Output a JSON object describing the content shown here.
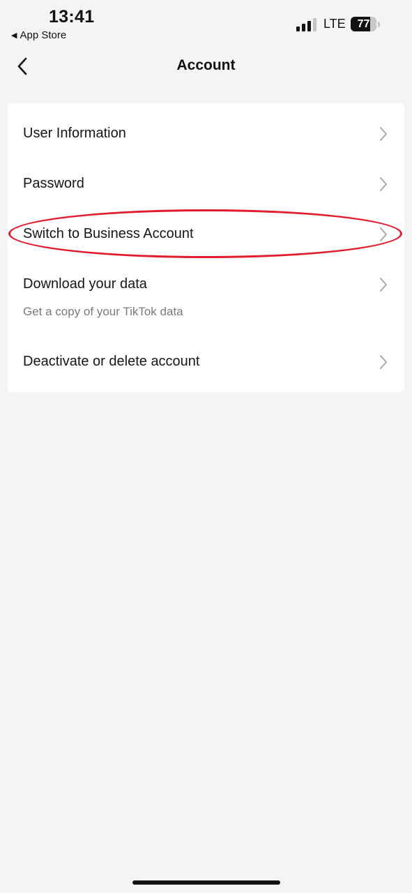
{
  "status_bar": {
    "time": "13:41",
    "back_app_label": "App Store",
    "back_arrow_glyph": "◀",
    "network": "LTE",
    "battery": "77",
    "battery_level": 0.77,
    "signal_bars_active": 3,
    "signal_bars_total": 4
  },
  "header": {
    "title": "Account",
    "back_icon": "chevron-left-icon"
  },
  "menu": {
    "items": [
      {
        "label": "User Information",
        "icon": "chevron-right-icon"
      },
      {
        "label": "Password",
        "icon": "chevron-right-icon"
      },
      {
        "label": "Switch to Business Account",
        "icon": "chevron-right-icon",
        "highlighted": true
      },
      {
        "label": "Download your data",
        "subtitle": "Get a copy of your TikTok data",
        "icon": "chevron-right-icon"
      },
      {
        "label": "Deactivate or delete account",
        "icon": "chevron-right-icon"
      }
    ]
  },
  "colors": {
    "background": "#f4f4f4",
    "card": "#ffffff",
    "highlight_ring": "#e21b2d",
    "chevron": "#a8a8a8",
    "subtitle": "#7a7a7a"
  }
}
